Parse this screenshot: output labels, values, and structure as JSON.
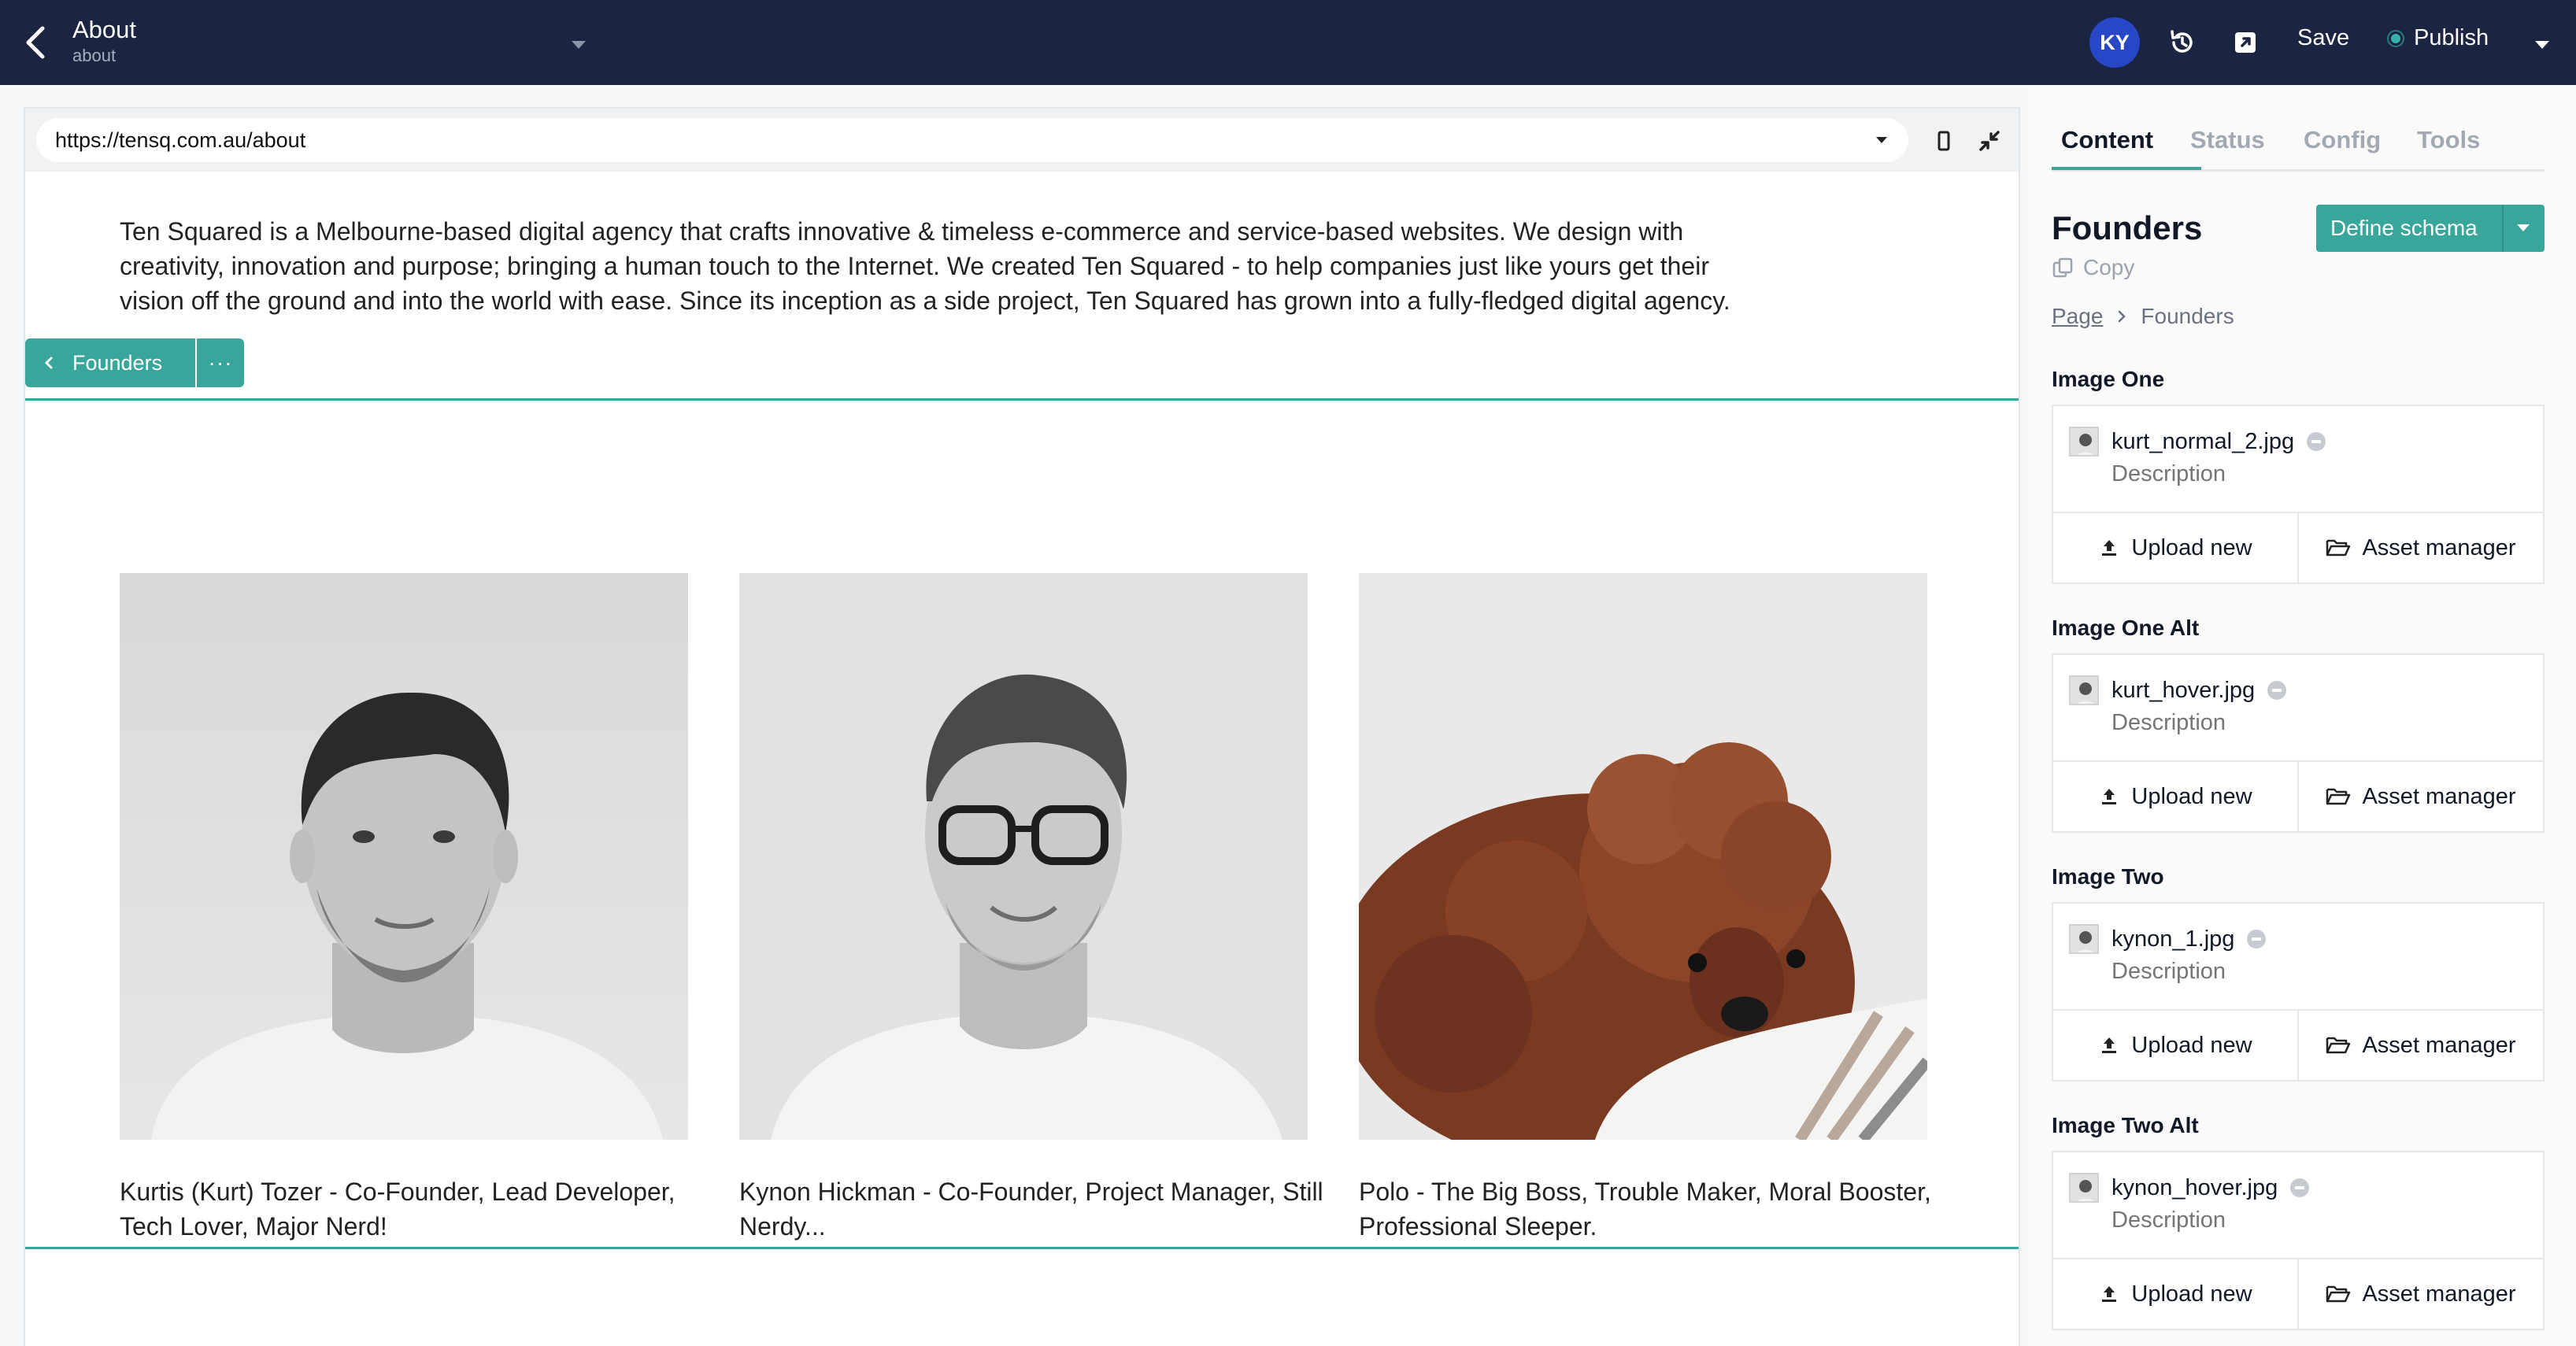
{
  "topbar": {
    "title": "About",
    "slug": "about",
    "avatar_initials": "KY",
    "save_label": "Save",
    "publish_label": "Publish",
    "colors": {
      "bar": "#1b2440",
      "avatar": "#2747c6",
      "publish_dot": "#38b2ac"
    }
  },
  "preview": {
    "url": "https://tensq.com.au/about",
    "intro": "Ten Squared is a Melbourne-based digital agency that crafts innovative & timeless e-commerce and service-based websites. We design with creativity, innovation and purpose; bringing a human touch to the Internet. We created Ten Squared - to help companies just like yours get their vision off the ground and into the world with ease. Since its inception as a side project, Ten Squared has grown into a fully-fledged digital agency.",
    "block_label": "Founders",
    "block_more": "···",
    "accent": "#38a69b",
    "founders": [
      {
        "caption": "Kurtis (Kurt) Tozer - Co-Founder, Lead Developer, Tech Lover, Major Nerd!"
      },
      {
        "caption": "Kynon Hickman - Co-Founder, Project Manager, Still Nerdy..."
      },
      {
        "caption": "Polo - The Big Boss, Trouble Maker, Moral Booster, Professional Sleeper."
      }
    ]
  },
  "panel": {
    "tabs": [
      "Content",
      "Status",
      "Config",
      "Tools"
    ],
    "active_tab": "Content",
    "block_title": "Founders",
    "copy_label": "Copy",
    "define_schema_label": "Define schema",
    "breadcrumb": {
      "root": "Page",
      "current": "Founders"
    },
    "upload_label": "Upload new",
    "asset_manager_label": "Asset manager",
    "fields": [
      {
        "label": "Image One",
        "file": "kurt_normal_2.jpg",
        "description_placeholder": "Description"
      },
      {
        "label": "Image One Alt",
        "file": "kurt_hover.jpg",
        "description_placeholder": "Description"
      },
      {
        "label": "Image Two",
        "file": "kynon_1.jpg",
        "description_placeholder": "Description"
      },
      {
        "label": "Image Two Alt",
        "file": "kynon_hover.jpg",
        "description_placeholder": "Description"
      }
    ]
  }
}
